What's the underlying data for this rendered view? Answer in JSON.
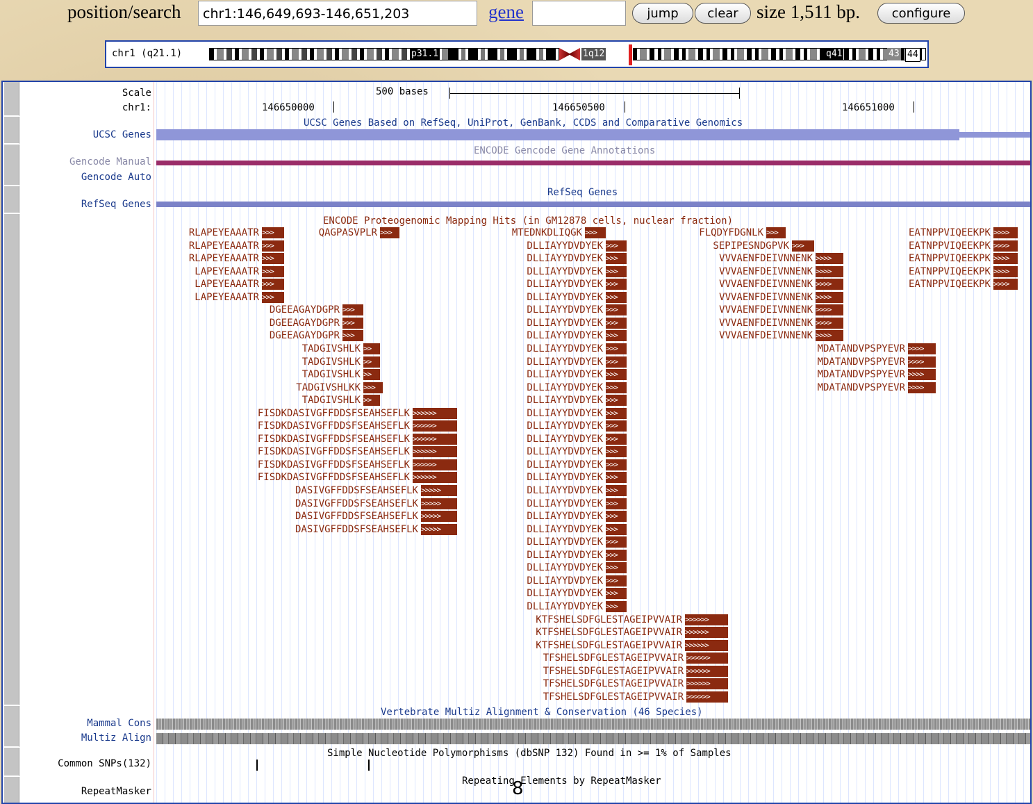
{
  "topbar": {
    "position_label": "position/search",
    "position_value": "chr1:146,649,693-146,651,203",
    "gene_link": "gene",
    "gene_value": "",
    "jump_label": "jump",
    "clear_label": "clear",
    "size_label": "size 1,511 bp.",
    "configure_label": "configure"
  },
  "ideogram": {
    "label": "chr1 (q21.1)",
    "bands": [
      "p31.1",
      "1q12",
      "q41",
      "43",
      "44"
    ]
  },
  "ruler": {
    "scale_label": "Scale",
    "chrom_label": "chr1:",
    "scale_bar_text": "500 bases",
    "ticks": [
      "146650000",
      "146650500",
      "146651000"
    ]
  },
  "tracks": {
    "ucsc_title": "UCSC Genes Based on RefSeq, UniProt, GenBank, CCDS and Comparative Genomics",
    "ucsc_label": "UCSC Genes",
    "gencode_title": "ENCODE Gencode Gene Annotations",
    "gencode_manual_label": "Gencode Manual",
    "gencode_auto_label": "Gencode Auto",
    "refseq_title": "RefSeq Genes",
    "refseq_label": "RefSeq Genes",
    "proteo_title": "ENCODE Proteogenomic Mapping Hits (in GM12878 cells, nuclear fraction)",
    "cons_title": "Vertebrate Multiz Alignment & Conservation (46 Species)",
    "mammal_label": "Mammal Cons",
    "multiz_label": "Multiz Align",
    "snp_title": "Simple Nucleotide Polymorphisms (dbSNP 132) Found in >= 1% of Samples",
    "snp_label": "Common SNPs(132)",
    "rmsk_title": "Repeating Elements by RepeatMasker",
    "rmsk_label": "RepeatMasker",
    "overlay_number": "8"
  },
  "peptides": [
    {
      "text": "RLAPEYEAAATR",
      "arrows": ">>>"
    },
    {
      "text": "QAGPASVPLR",
      "arrows": ">>>"
    },
    {
      "text": "MTEDNKDLIQGK",
      "arrows": ">>>"
    },
    {
      "text": "FLQDYFDGNLK",
      "arrows": ">>>"
    },
    {
      "text": "EATNPPVIQEEKPK",
      "arrows": ">>>>"
    },
    {
      "text": "LAPEYEAAATR",
      "arrows": ">>>"
    },
    {
      "text": "DGEEAGAYDGPR",
      "arrows": ">>>"
    },
    {
      "text": "DLLIAYYDVDYEK",
      "arrows": ">>>"
    },
    {
      "text": "SEPIPESNDGPVK",
      "arrows": ">>>"
    },
    {
      "text": "VVVAENFDEIVNNENK",
      "arrows": ">>>>"
    },
    {
      "text": "TADGIVSHLK",
      "arrows": ">>"
    },
    {
      "text": "TADGIVSHLKK",
      "arrows": ">>>"
    },
    {
      "text": "MDATANDVPSPYEVR",
      "arrows": ">>>>"
    },
    {
      "text": "FISDKDASIVGFFDDSFSEAHSEFLK",
      "arrows": ">>>>>>"
    },
    {
      "text": "DASIVGFFDDSFSEAHSEFLK",
      "arrows": ">>>>>"
    },
    {
      "text": "KTFSHELSDFGLESTAGEIPVVAIR",
      "arrows": ">>>>>>"
    },
    {
      "text": "TFSHELSDFGLESTAGEIPVVAIR",
      "arrows": ">>>>>>"
    }
  ]
}
